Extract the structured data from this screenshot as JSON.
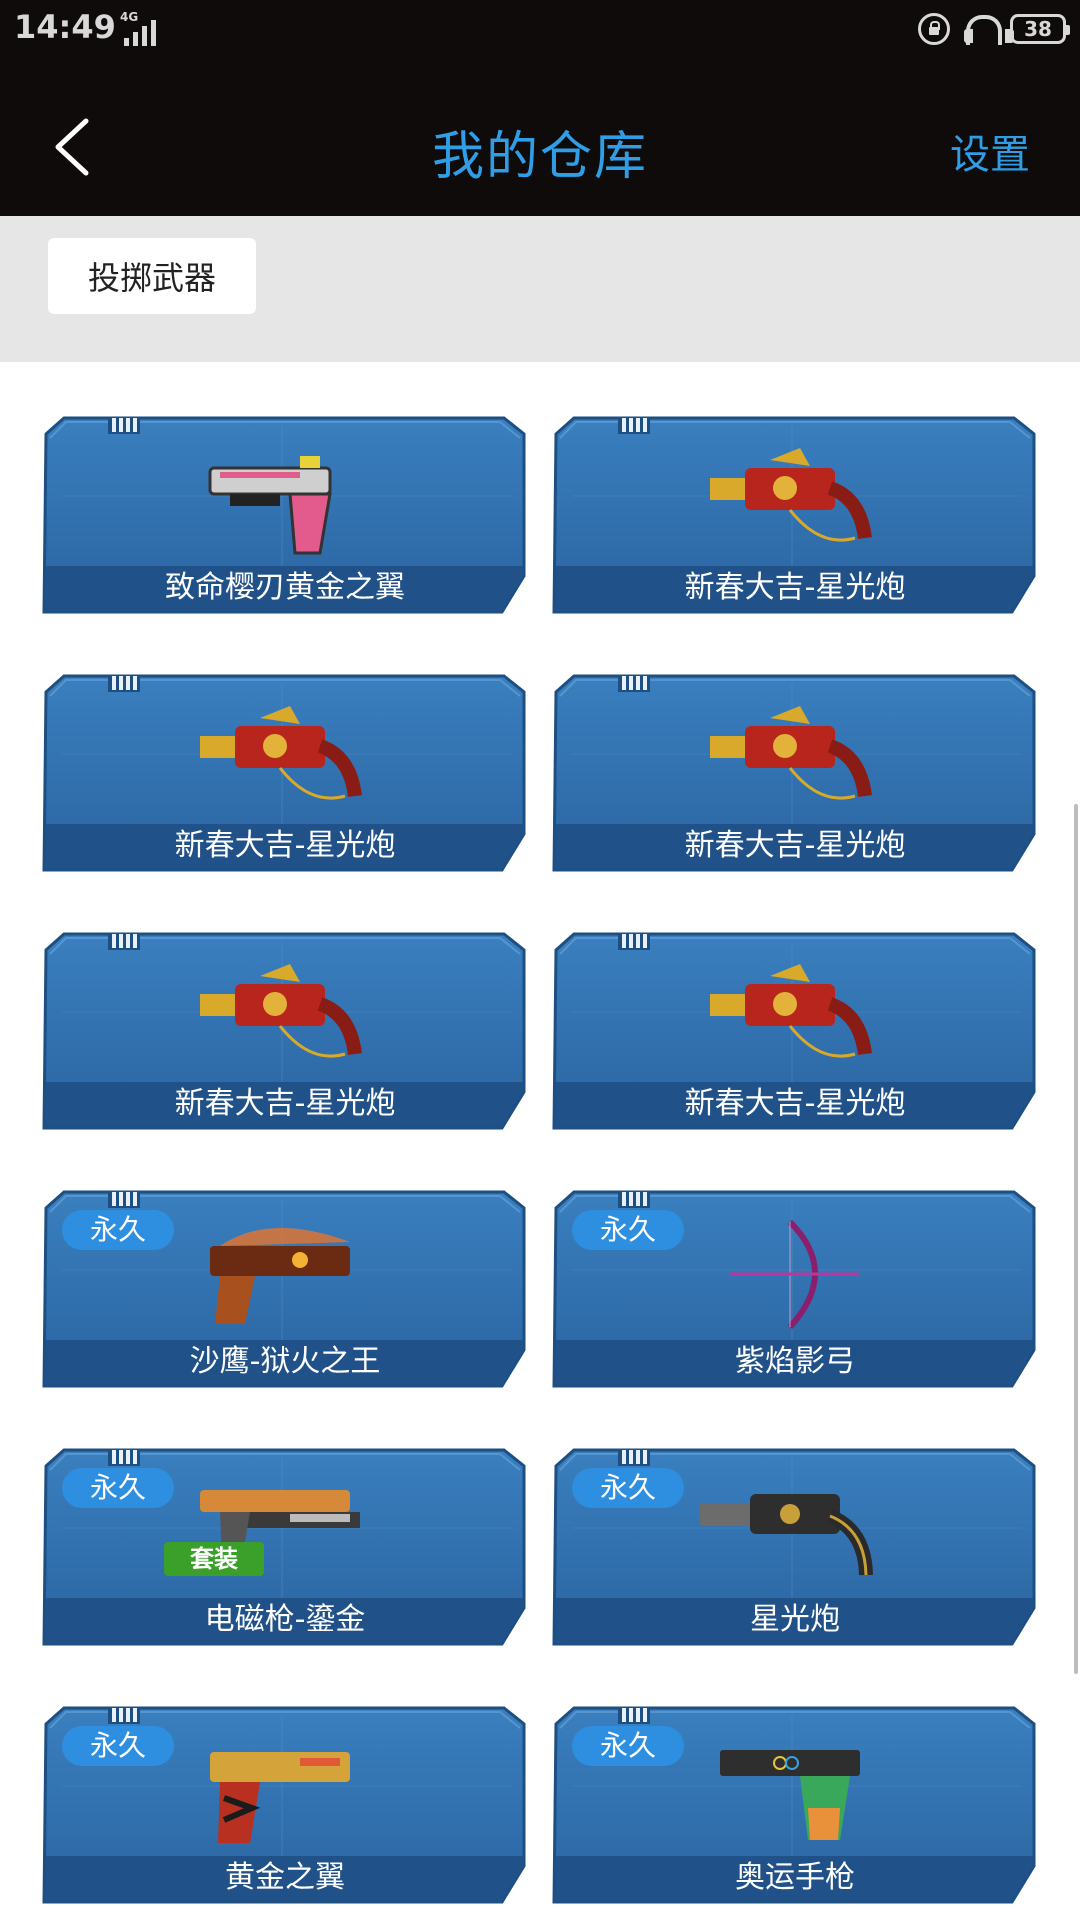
{
  "status": {
    "time": "14:49",
    "network": "4G",
    "battery": "38"
  },
  "nav": {
    "title": "我的仓库",
    "settings_label": "设置"
  },
  "filter": {
    "chip_label": "投掷武器"
  },
  "colors": {
    "accent": "#2f9ee6",
    "card_blue": "#2f6ea8",
    "badge_perm": "#2e8fe0",
    "badge_set": "#3aa02a"
  },
  "items": [
    {
      "name": "致命樱刃黄金之翼",
      "permanent": "",
      "set": "",
      "icon": "pink-pistol-icon"
    },
    {
      "name": "新春大吉-星光炮",
      "permanent": "",
      "set": "",
      "icon": "red-gold-cannon-icon"
    },
    {
      "name": "新春大吉-星光炮",
      "permanent": "",
      "set": "",
      "icon": "red-gold-cannon-icon"
    },
    {
      "name": "新春大吉-星光炮",
      "permanent": "",
      "set": "",
      "icon": "red-gold-cannon-icon"
    },
    {
      "name": "新春大吉-星光炮",
      "permanent": "",
      "set": "",
      "icon": "red-gold-cannon-icon"
    },
    {
      "name": "新春大吉-星光炮",
      "permanent": "",
      "set": "",
      "icon": "red-gold-cannon-icon"
    },
    {
      "name": "沙鹰-狱火之王",
      "permanent": "永久",
      "set": "",
      "icon": "flame-pistol-icon"
    },
    {
      "name": "紫焰影弓",
      "permanent": "永久",
      "set": "",
      "icon": "purple-bow-icon"
    },
    {
      "name": "电磁枪-鎏金",
      "permanent": "永久",
      "set": "套装",
      "icon": "gold-railgun-icon"
    },
    {
      "name": "星光炮",
      "permanent": "永久",
      "set": "",
      "icon": "dark-cannon-icon"
    },
    {
      "name": "黄金之翼",
      "permanent": "永久",
      "set": "",
      "icon": "gold-pistol-icon"
    },
    {
      "name": "奥运手枪",
      "permanent": "永久",
      "set": "",
      "icon": "olympic-pistol-icon"
    }
  ]
}
